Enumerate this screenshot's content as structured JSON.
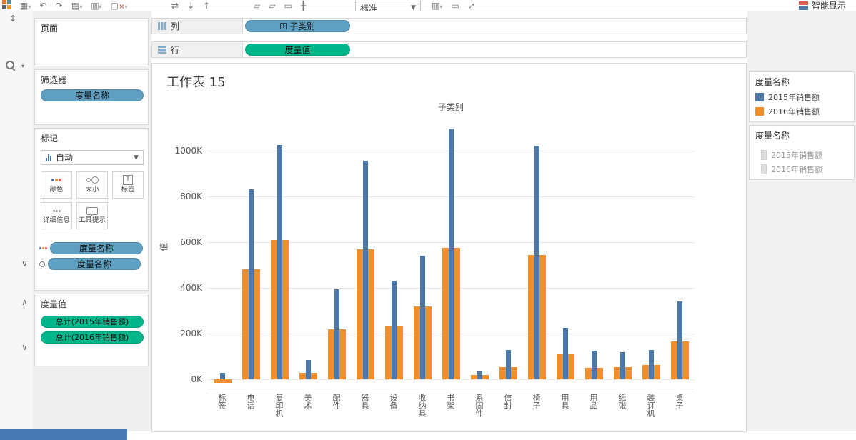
{
  "toolbar": {
    "fit_mode": "标准",
    "show_me_label": "智能显示"
  },
  "left_panel": {
    "pages_title": "页面",
    "filters_title": "筛选器",
    "filters_pills": [
      "度量名称"
    ],
    "marks": {
      "title": "标记",
      "mark_type": "自动",
      "buttons": [
        {
          "name": "color",
          "label": "颜色"
        },
        {
          "name": "size",
          "label": "大小"
        },
        {
          "name": "label",
          "label": "标签"
        },
        {
          "name": "detail",
          "label": "详细信息"
        },
        {
          "name": "tooltip",
          "label": "工具提示"
        }
      ],
      "pills": [
        "度量名称",
        "度量名称"
      ]
    },
    "measure_values": {
      "title": "度量值",
      "pills": [
        "总计(2015年销售额)",
        "总计(2016年销售额)"
      ]
    }
  },
  "shelves": {
    "columns_label": "列",
    "columns_pills": [
      "子类别"
    ],
    "rows_label": "行",
    "rows_pills": [
      "度量值"
    ]
  },
  "sheet": {
    "title": "工作表 15"
  },
  "legends": [
    {
      "title": "度量名称",
      "muted": false,
      "items": [
        {
          "label": "2015年销售额",
          "color": "#4e79a7"
        },
        {
          "label": "2016年销售额",
          "color": "#f28e2b"
        }
      ]
    },
    {
      "title": "度量名称",
      "muted": true,
      "items": [
        {
          "label": "2015年销售额",
          "color": "#dcdcdc"
        },
        {
          "label": "2016年销售额",
          "color": "#dcdcdc"
        }
      ]
    }
  ],
  "chart_data": {
    "type": "bar",
    "title": "子类别",
    "ylabel": "值",
    "unit": "K",
    "ylim": [
      -40,
      1140
    ],
    "ytick_values": [
      0,
      200,
      400,
      600,
      800,
      1000
    ],
    "ytick_labels": [
      "0K",
      "200K",
      "400K",
      "600K",
      "800K",
      "1000K"
    ],
    "grid": true,
    "legend_position": "right",
    "categories": [
      "标签",
      "电话",
      "复印机",
      "美术",
      "配件",
      "器具",
      "设备",
      "收纳具",
      "书架",
      "系固件",
      "信封",
      "椅子",
      "用具",
      "用品",
      "纸张",
      "装订机",
      "桌子"
    ],
    "series": [
      {
        "name": "2015年销售额",
        "color": "#4e79a7",
        "bar_width": "thin",
        "values": [
          30,
          830,
          1025,
          85,
          395,
          955,
          430,
          540,
          1095,
          35,
          130,
          1020,
          225,
          125,
          120,
          130,
          340
        ]
      },
      {
        "name": "2016年销售额",
        "color": "#f28e2b",
        "bar_width": "wide",
        "values": [
          -15,
          480,
          610,
          30,
          220,
          570,
          235,
          320,
          575,
          18,
          55,
          545,
          110,
          50,
          55,
          62,
          165
        ]
      }
    ]
  }
}
